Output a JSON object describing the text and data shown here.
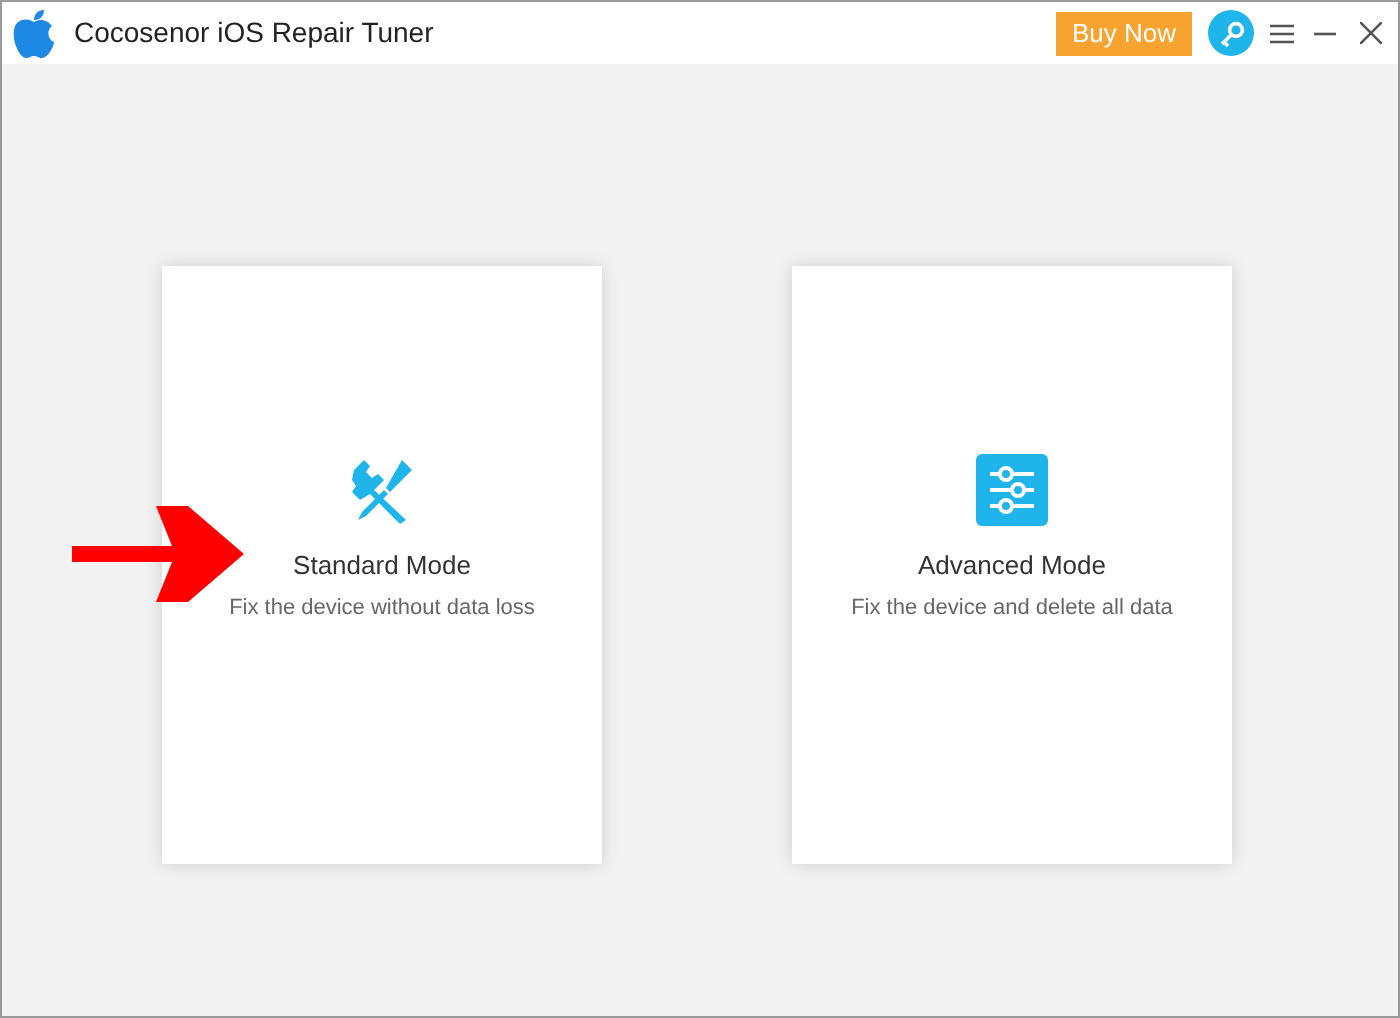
{
  "window": {
    "title": "Cocosenor iOS Repair Tuner",
    "buy_button": "Buy Now"
  },
  "modes": [
    {
      "kind": "tools",
      "title": "Standard Mode",
      "description": "Fix the device without data loss",
      "pointed": true
    },
    {
      "kind": "sliders",
      "title": "Advanced Mode",
      "description": "Fix the device and delete all data",
      "pointed": false
    }
  ]
}
